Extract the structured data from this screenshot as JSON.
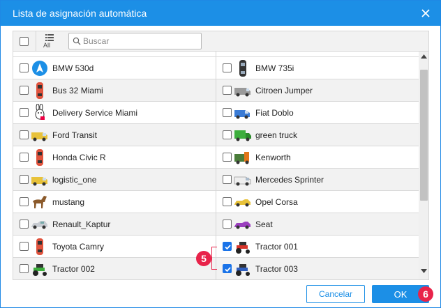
{
  "dialog": {
    "title": "Lista de asignación automática"
  },
  "toolbar": {
    "all_label": "All",
    "search_placeholder": "Buscar"
  },
  "rows": [
    {
      "left": {
        "label": "BMW 530d",
        "icon": "navigation-arrow-icon",
        "checked": false
      },
      "right": {
        "label": "BMW 735i",
        "icon": "black-car-icon",
        "checked": false
      }
    },
    {
      "left": {
        "label": "Bus 32 Miami",
        "icon": "red-car-icon",
        "checked": false
      },
      "right": {
        "label": "Citroen Jumper",
        "icon": "grey-van-icon",
        "checked": false
      }
    },
    {
      "left": {
        "label": "Delivery Service Miami",
        "icon": "rabbit-icon",
        "checked": false
      },
      "right": {
        "label": "Fiat Doblo",
        "icon": "blue-van-icon",
        "checked": false
      }
    },
    {
      "left": {
        "label": "Ford Transit",
        "icon": "yellow-van-icon",
        "checked": false
      },
      "right": {
        "label": "green truck",
        "icon": "green-truck-icon",
        "checked": false
      }
    },
    {
      "left": {
        "label": "Honda Civic R",
        "icon": "red-car-icon",
        "checked": false
      },
      "right": {
        "label": "Kenworth",
        "icon": "orange-truck-icon",
        "checked": false
      }
    },
    {
      "left": {
        "label": "logistic_one",
        "icon": "yellow-van-icon",
        "checked": false
      },
      "right": {
        "label": "Mercedes Sprinter",
        "icon": "white-van-icon",
        "checked": false
      }
    },
    {
      "left": {
        "label": "mustang",
        "icon": "horse-icon",
        "checked": false
      },
      "right": {
        "label": "Opel Corsa",
        "icon": "yellow-car-icon",
        "checked": false
      }
    },
    {
      "left": {
        "label": "Renault_Kaptur",
        "icon": "silver-car-icon",
        "checked": false
      },
      "right": {
        "label": "Seat",
        "icon": "purple-car-icon",
        "checked": false
      }
    },
    {
      "left": {
        "label": "Toyota Camry",
        "icon": "red-car-icon",
        "checked": false
      },
      "right": {
        "label": "Tractor 001",
        "icon": "red-tractor-icon",
        "checked": true
      }
    },
    {
      "left": {
        "label": "Tractor 002",
        "icon": "green-tractor-icon",
        "checked": false
      },
      "right": {
        "label": "Tractor 003",
        "icon": "blue-tractor-icon",
        "checked": true
      }
    }
  ],
  "footer": {
    "cancel_label": "Cancelar",
    "ok_label": "OK"
  },
  "callouts": {
    "selection": "5",
    "ok": "6"
  },
  "colors": {
    "accent": "#1c8fe6",
    "callout": "#e8234a",
    "checked": "#1a73e8"
  }
}
